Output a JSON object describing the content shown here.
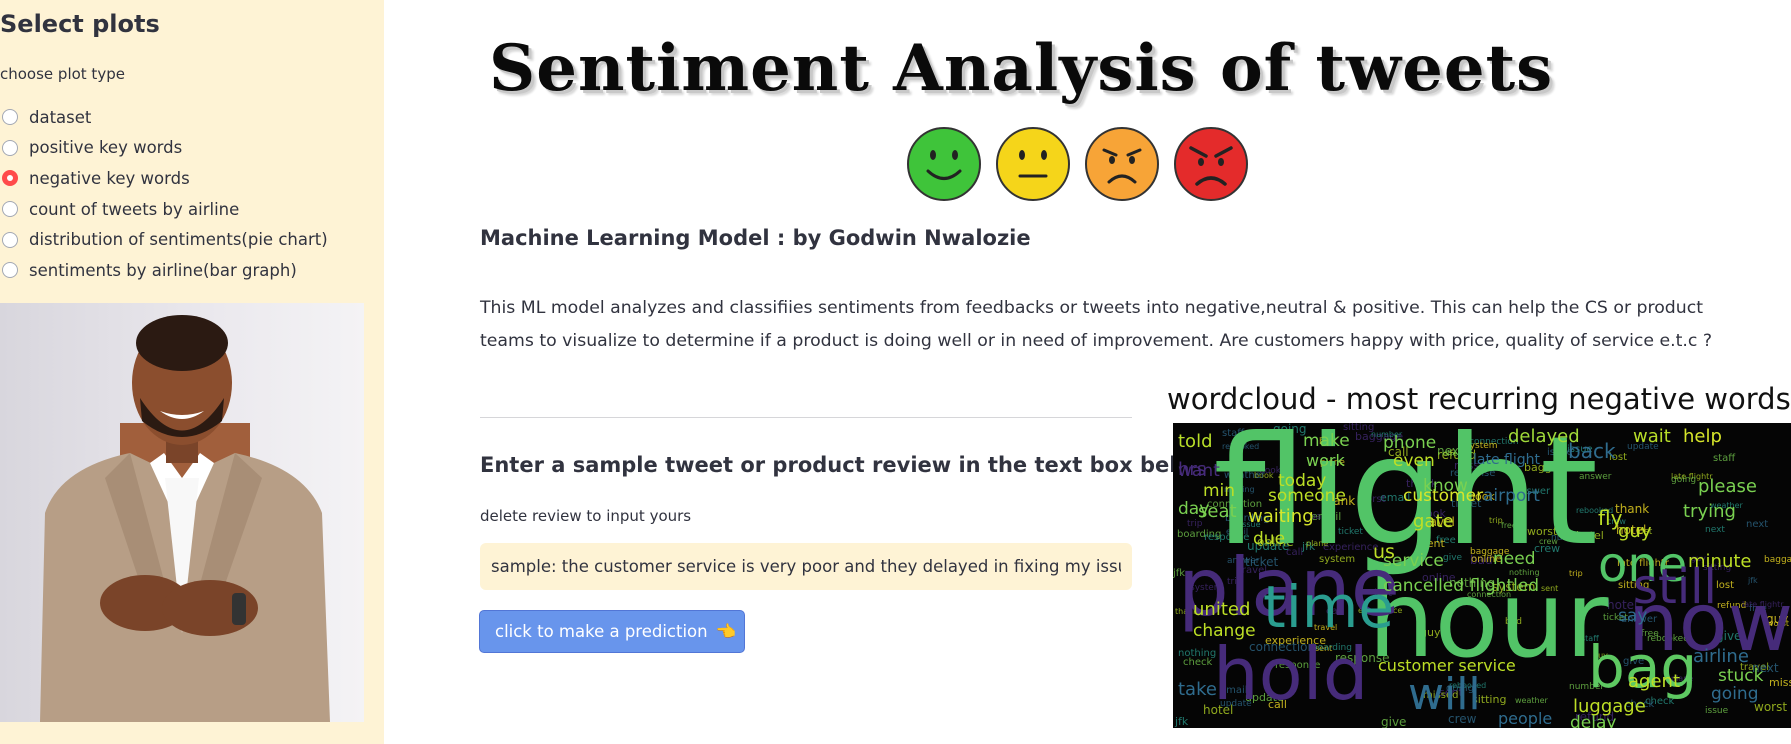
{
  "sidebar": {
    "title": "Select plots",
    "radio_label": "choose plot type",
    "options": [
      {
        "label": "dataset",
        "selected": false
      },
      {
        "label": "positive key words",
        "selected": false
      },
      {
        "label": "negative key words",
        "selected": true
      },
      {
        "label": "count of tweets by airline",
        "selected": false
      },
      {
        "label": "distribution of sentiments(pie chart)",
        "selected": false
      },
      {
        "label": "sentiments by airline(bar graph)",
        "selected": false
      }
    ]
  },
  "main": {
    "title": "Sentiment Analysis of tweets",
    "author": "Machine Learning Model : by Godwin Nwalozie",
    "description": "This ML model analyzes and classifiies sentiments from feedbacks or tweets into negative,neutral & positive. This can help the CS or product teams to visualize to determine if a product is doing well or in need of improvement. Are customers happy with price, quality of service e.t.c ?",
    "input_heading": "Enter a sample tweet or product review in the text box below",
    "input_note": "delete review to input yours",
    "input_value": "sample: the customer service is very poor and they delayed in fixing my issues",
    "predict_button": "click to make a prediction",
    "predict_emoji": "👈",
    "wordcloud_title": "wordcloud - most recurring negative words"
  },
  "emoji_colors": [
    "#3fc43a",
    "#f5d51a",
    "#f7a437",
    "#e42b2b"
  ],
  "wordcloud_words": [
    {
      "t": "flight",
      "c": "#52c467"
    },
    {
      "t": "hour",
      "c": "#52c467"
    },
    {
      "t": "now",
      "c": "#462b7a"
    },
    {
      "t": "plane",
      "c": "#462b7a"
    },
    {
      "t": "hold",
      "c": "#462b7a"
    },
    {
      "t": "bag",
      "c": "#5ec962"
    },
    {
      "t": "time",
      "c": "#2a9d8f"
    },
    {
      "t": "one",
      "c": "#52c467"
    },
    {
      "t": "still",
      "c": "#462b7a"
    },
    {
      "t": "will",
      "c": "#2f6c8e"
    },
    {
      "t": "cancelled flightled",
      "c": "#7ad151"
    },
    {
      "t": "customer service",
      "c": "#bddf26"
    },
    {
      "t": "delayed",
      "c": "#a0da39"
    },
    {
      "t": "waiting",
      "c": "#d6e52a"
    },
    {
      "t": "customer",
      "c": "#d6e52a"
    },
    {
      "t": "help",
      "c": "#d6e52a"
    },
    {
      "t": "wait",
      "c": "#b8de29"
    },
    {
      "t": "luggage",
      "c": "#bddf26"
    },
    {
      "t": "agent",
      "c": "#bddf26"
    },
    {
      "t": "gate",
      "c": "#bddf26"
    },
    {
      "t": "know",
      "c": "#7ad151"
    },
    {
      "t": "told",
      "c": "#b8de29"
    },
    {
      "t": "back",
      "c": "#2f6c8e"
    },
    {
      "t": "service",
      "c": "#7ad151"
    },
    {
      "t": "need",
      "c": "#7ad151"
    },
    {
      "t": "united",
      "c": "#bddf26"
    },
    {
      "t": "change",
      "c": "#bddf26"
    },
    {
      "t": "take",
      "c": "#2f6c8e"
    },
    {
      "t": "people",
      "c": "#2f6c8e"
    },
    {
      "t": "delay",
      "c": "#7ad151"
    },
    {
      "t": "fly",
      "c": "#bddf26"
    },
    {
      "t": "guy",
      "c": "#bddf26"
    },
    {
      "t": "minute",
      "c": "#bddf26"
    },
    {
      "t": "please",
      "c": "#7ad151"
    },
    {
      "t": "trying",
      "c": "#7ad151"
    },
    {
      "t": "today",
      "c": "#bddf26"
    },
    {
      "t": "someone",
      "c": "#bddf26"
    },
    {
      "t": "phone",
      "c": "#7ad151"
    },
    {
      "t": "due",
      "c": "#bddf26"
    },
    {
      "t": "min",
      "c": "#bddf26"
    },
    {
      "t": "seat",
      "c": "#7ad151"
    },
    {
      "t": "airline",
      "c": "#2f6c8e"
    },
    {
      "t": "say",
      "c": "#2f6c8e"
    },
    {
      "t": "going",
      "c": "#2f6c8e"
    },
    {
      "t": "stuck",
      "c": "#7ad151"
    },
    {
      "t": "us",
      "c": "#bddf26"
    },
    {
      "t": "late flight",
      "c": "#2f6c8e"
    },
    {
      "t": "hrs",
      "c": "#462b7a"
    },
    {
      "t": "want",
      "c": "#462b7a"
    },
    {
      "t": "day",
      "c": "#7ad151"
    },
    {
      "t": "even",
      "c": "#bddf26"
    },
    {
      "t": "work",
      "c": "#7ad151"
    },
    {
      "t": "make",
      "c": "#7ad151"
    },
    {
      "t": "airport",
      "c": "#2f6c8e"
    }
  ]
}
